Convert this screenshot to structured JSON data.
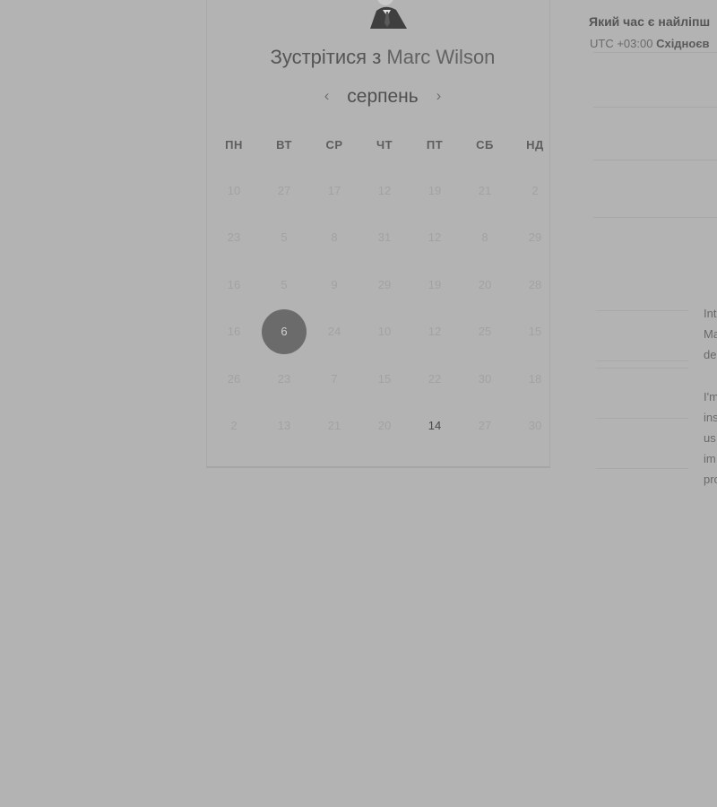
{
  "booking": {
    "title_prefix": "Зустрітися з",
    "host_name": "Marc Wilson",
    "month": "серпень",
    "prev_icon": "chevron-left-icon",
    "next_icon": "chevron-right-icon"
  },
  "calendar": {
    "weekdays": [
      "ПН",
      "ВТ",
      "СР",
      "ЧТ",
      "ПТ",
      "СБ",
      "НД"
    ],
    "rows": [
      [
        "10",
        "27",
        "17",
        "12",
        "19",
        "21",
        "2"
      ],
      [
        "23",
        "5",
        "8",
        "31",
        "12",
        "8",
        "29"
      ],
      [
        "16",
        "5",
        "9",
        "29",
        "19",
        "20",
        "28"
      ],
      [
        "16",
        "6",
        "24",
        "10",
        "12",
        "25",
        "15"
      ],
      [
        "26",
        "23",
        "7",
        "15",
        "22",
        "30",
        "18"
      ],
      [
        "2",
        "13",
        "21",
        "20",
        "14",
        "27",
        "30"
      ]
    ],
    "selected_day": "6",
    "available_days": [
      "14"
    ]
  },
  "timezone": {
    "question": "Який час є найліпш",
    "offset": "UTC +03:00",
    "zone": "Східноєв"
  },
  "description": {
    "lines": [
      "Int",
      "Ma",
      "de",
      "",
      "I'm",
      "ins",
      "us",
      "im",
      "pro"
    ]
  }
}
